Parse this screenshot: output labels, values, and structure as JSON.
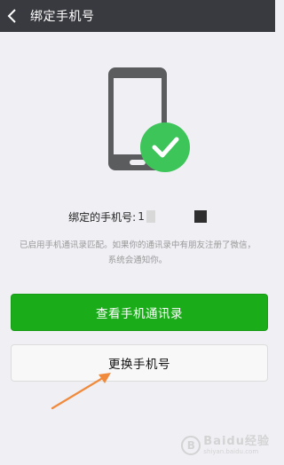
{
  "header": {
    "title": "绑定手机号",
    "back_icon": "back-arrow-icon"
  },
  "illustration": {
    "phone_icon": "phone-icon",
    "check_icon": "check-circle-icon",
    "phone_color": "#5b5c5e",
    "check_color": "#3ec55a"
  },
  "bound": {
    "label": "绑定的手机号:",
    "visible_digit": "1"
  },
  "description": "已启用手机通讯录匹配。如果你的通讯录中有朋友注册了微信，系统会通知你。",
  "actions": {
    "view_contacts": "查看手机通讯录",
    "change_number": "更换手机号"
  },
  "annotation": {
    "arrow_color": "#f08a3c"
  },
  "watermark": {
    "main": "Baidu经验",
    "sub": "shiyan.baidu.com",
    "logo_glyph": "B"
  },
  "colors": {
    "topbar": "#393a3f",
    "primary": "#1aad19",
    "background": "#efeff4"
  }
}
